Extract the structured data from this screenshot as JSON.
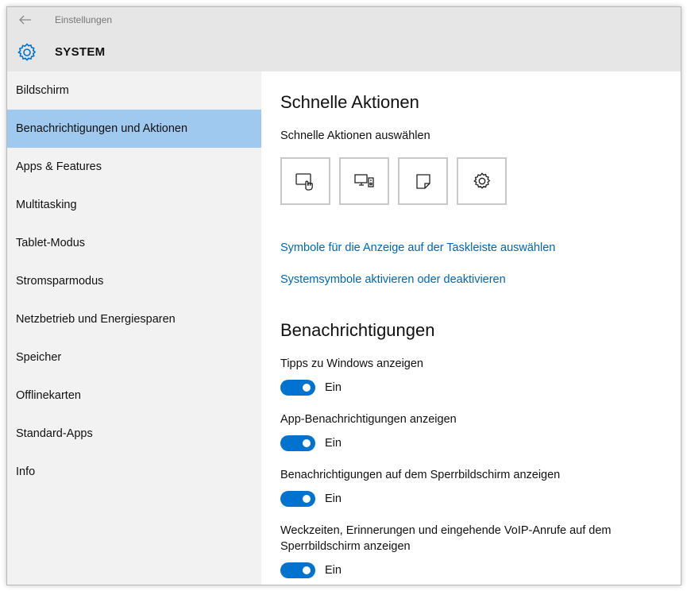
{
  "window": {
    "title": "Einstellungen",
    "section": "SYSTEM",
    "accent_color": "#0072d0",
    "selected_nav_color": "#9fc9ee"
  },
  "sidebar": {
    "items": [
      {
        "label": "Bildschirm",
        "selected": false
      },
      {
        "label": "Benachrichtigungen und Aktionen",
        "selected": true
      },
      {
        "label": "Apps & Features",
        "selected": false
      },
      {
        "label": "Multitasking",
        "selected": false
      },
      {
        "label": "Tablet-Modus",
        "selected": false
      },
      {
        "label": "Stromsparmodus",
        "selected": false
      },
      {
        "label": "Netzbetrieb und Energiesparen",
        "selected": false
      },
      {
        "label": "Speicher",
        "selected": false
      },
      {
        "label": "Offlinekarten",
        "selected": false
      },
      {
        "label": "Standard-Apps",
        "selected": false
      },
      {
        "label": "Info",
        "selected": false
      }
    ]
  },
  "quick_actions": {
    "title": "Schnelle Aktionen",
    "subtitle": "Schnelle Aktionen auswählen",
    "tiles": [
      {
        "icon": "tablet-mode-icon"
      },
      {
        "icon": "connect-icon"
      },
      {
        "icon": "note-icon"
      },
      {
        "icon": "settings-icon"
      }
    ],
    "links": [
      "Symbole für die Anzeige auf der Taskleiste auswählen",
      "Systemsymbole aktivieren oder deaktivieren"
    ]
  },
  "notifications": {
    "title": "Benachrichtigungen",
    "toggles": [
      {
        "label": "Tipps zu Windows anzeigen",
        "state": "Ein",
        "on": true
      },
      {
        "label": "App-Benachrichtigungen anzeigen",
        "state": "Ein",
        "on": true
      },
      {
        "label": "Benachrichtigungen auf dem Sperrbildschirm anzeigen",
        "state": "Ein",
        "on": true
      },
      {
        "label": "Weckzeiten, Erinnerungen und eingehende VoIP-Anrufe auf dem",
        "label_line2": "Sperrbildschirm anzeigen",
        "state": "Ein",
        "on": true
      }
    ]
  }
}
